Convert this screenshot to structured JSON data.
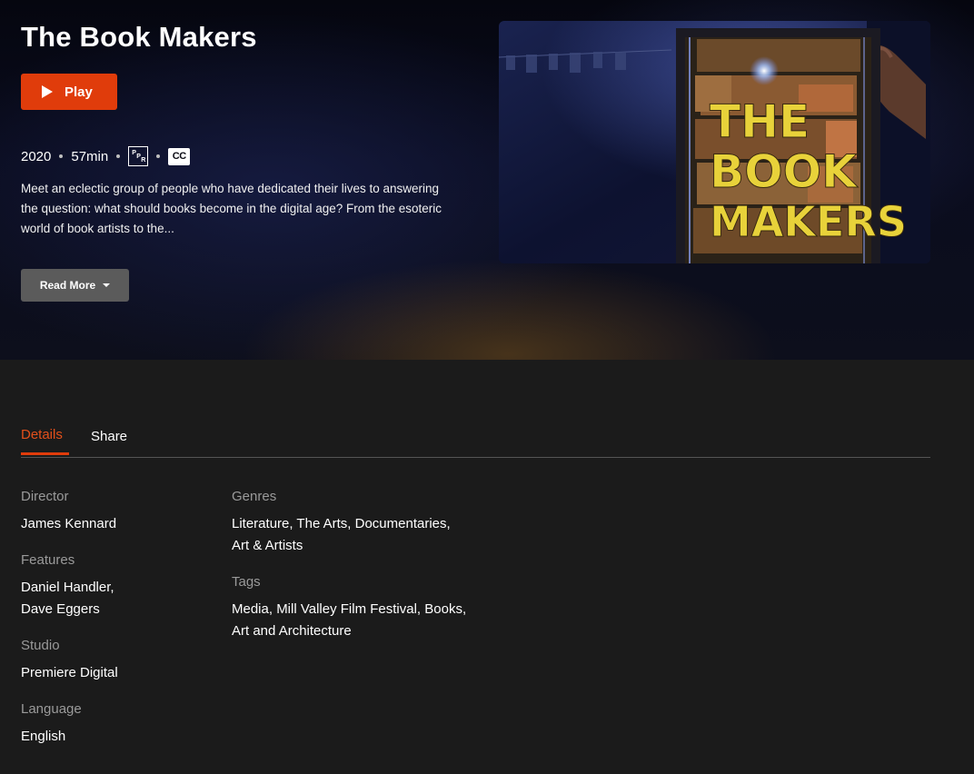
{
  "hero": {
    "title": "The Book Makers",
    "play_label": "Play",
    "year": "2020",
    "duration": "57min",
    "rating": "PPR",
    "cc_label": "CC",
    "description": "Meet an eclectic group of people who have dedicated their lives to answering the question: what should books become in the digital age? From the esoteric world of book artists to the...",
    "read_more_label": "Read More",
    "poster": {
      "title_lines": [
        "THE",
        "BOOK",
        "MAKERS"
      ]
    }
  },
  "tabs": [
    {
      "label": "Details",
      "active": true
    },
    {
      "label": "Share",
      "active": false
    }
  ],
  "details": {
    "director": {
      "label": "Director",
      "value": "James Kennard"
    },
    "features": {
      "label": "Features",
      "lines": [
        "Daniel Handler,",
        "Dave Eggers"
      ]
    },
    "studio": {
      "label": "Studio",
      "value": "Premiere Digital"
    },
    "language": {
      "label": "Language",
      "value": "English"
    },
    "genres": {
      "label": "Genres",
      "lines": [
        "Literature, The Arts, Documentaries,",
        "Art & Artists"
      ]
    },
    "tags": {
      "label": "Tags",
      "lines": [
        "Media, Mill Valley Film Festival, Books,",
        "Art and Architecture"
      ]
    }
  },
  "colors": {
    "accent": "#e03c0b",
    "background": "#1b1b1b",
    "read_more_bg": "#5b5b5b"
  },
  "icons": {
    "play": "play-icon",
    "caret": "caret-down-icon",
    "rating": "rating-badge-icon",
    "captions": "closed-captions-icon"
  }
}
